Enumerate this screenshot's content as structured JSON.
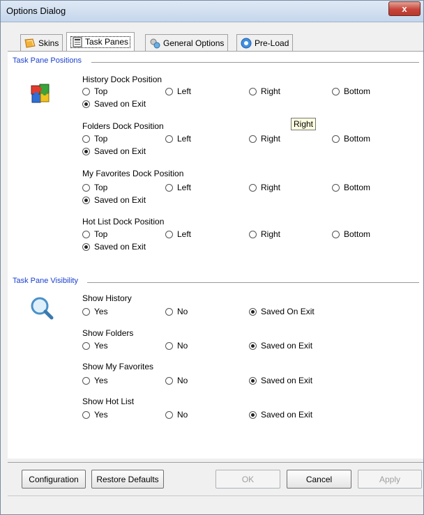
{
  "window": {
    "title": "Options Dialog",
    "close_label": "x"
  },
  "tabs": [
    {
      "label": "Skins",
      "icon": "skins-icon"
    },
    {
      "label": "Task Panes",
      "icon": "task-panes-icon"
    },
    {
      "label": "General Options",
      "icon": "general-options-icon"
    },
    {
      "label": "Pre-Load",
      "icon": "pre-load-icon"
    }
  ],
  "positions": {
    "section_title": "Task Pane Positions",
    "options": [
      "Top",
      "Left",
      "Right",
      "Bottom",
      "Saved on Exit"
    ],
    "groups": [
      {
        "label": "History Dock Position",
        "selected": "Saved on Exit"
      },
      {
        "label": "Folders Dock Position",
        "selected": "Saved on Exit"
      },
      {
        "label": "My Favorites Dock Position",
        "selected": "Saved on Exit"
      },
      {
        "label": "Hot List Dock Position",
        "selected": "Saved on Exit"
      }
    ]
  },
  "visibility": {
    "section_title": "Task Pane Visibility",
    "groups": [
      {
        "label": "Show History",
        "options": [
          "Yes",
          "No",
          "Saved On Exit"
        ],
        "selected": "Saved On Exit"
      },
      {
        "label": "Show Folders",
        "options": [
          "Yes",
          "No",
          "Saved on Exit"
        ],
        "selected": "Saved on Exit"
      },
      {
        "label": "Show My Favorites",
        "options": [
          "Yes",
          "No",
          "Saved on Exit"
        ],
        "selected": "Saved on Exit"
      },
      {
        "label": "Show Hot List",
        "options": [
          "Yes",
          "No",
          "Saved on Exit"
        ],
        "selected": "Saved on Exit"
      }
    ]
  },
  "tooltip": {
    "text": "Right"
  },
  "buttons": {
    "configuration": "Configuration",
    "restore_defaults": "Restore Defaults",
    "ok": "OK",
    "cancel": "Cancel",
    "apply": "Apply"
  }
}
